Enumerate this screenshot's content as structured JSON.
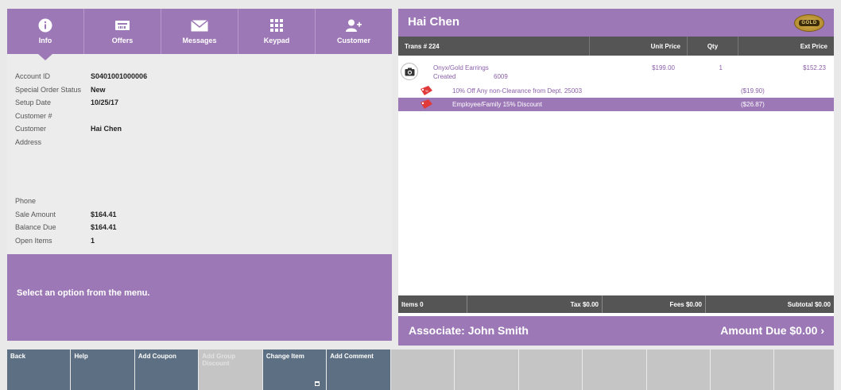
{
  "tabs": [
    {
      "label": "Info",
      "icon": "info-icon"
    },
    {
      "label": "Offers",
      "icon": "offers-icon"
    },
    {
      "label": "Messages",
      "icon": "envelope-icon"
    },
    {
      "label": "Keypad",
      "icon": "keypad-icon"
    },
    {
      "label": "Customer",
      "icon": "add-customer-icon"
    }
  ],
  "info": {
    "account_id_label": "Account ID",
    "account_id": "S0401001000006",
    "special_order_status_label": "Special Order Status",
    "special_order_status": "New",
    "setup_date_label": "Setup Date",
    "setup_date": "10/25/17",
    "customer_num_label": "Customer #",
    "customer_label": "Customer",
    "customer": "Hai Chen",
    "address_label": "Address",
    "phone_label": "Phone",
    "sale_amount_label": "Sale Amount",
    "sale_amount": "$164.41",
    "balance_due_label": "Balance Due",
    "balance_due": "$164.41",
    "open_items_label": "Open Items",
    "open_items": "1"
  },
  "message": "Select an option from the menu.",
  "transaction": {
    "customer_name": "Hai Chen",
    "logo_text": "GOLD",
    "columns": {
      "trans": "Trans # 224",
      "unit_price": "Unit Price",
      "qty": "Qty",
      "ext_price": "Ext Price"
    },
    "item": {
      "name": "Onyx/Gold Earrings",
      "status": "Created",
      "code": "6009",
      "unit_price": "$199.00",
      "qty": "1",
      "ext_price": "$152.23"
    },
    "discounts": [
      {
        "text": "10% Off Any non-Clearance from Dept. 25003",
        "amount": "($19.90)"
      },
      {
        "text": "Employee/Family 15% Discount",
        "amount": "($26.87)"
      }
    ],
    "totals": {
      "items": "Items 0",
      "tax": "Tax $0.00",
      "fees": "Fees $0.00",
      "subtotal": "Subtotal $0.00"
    },
    "associate": "Associate: John Smith",
    "amount_due": "Amount Due  $0.00 ›"
  },
  "bottom_buttons": [
    {
      "label": "Back",
      "state": "enabled"
    },
    {
      "label": "Help",
      "state": "enabled"
    },
    {
      "label": "Add Coupon",
      "state": "enabled"
    },
    {
      "label": "Add Group Discount",
      "state": "disabled"
    },
    {
      "label": "Change Item",
      "state": "enabled"
    },
    {
      "label": "Add Comment",
      "state": "enabled"
    }
  ],
  "colors": {
    "accent": "#9d78b6",
    "dark": "#555555",
    "button": "#5d6f82"
  }
}
